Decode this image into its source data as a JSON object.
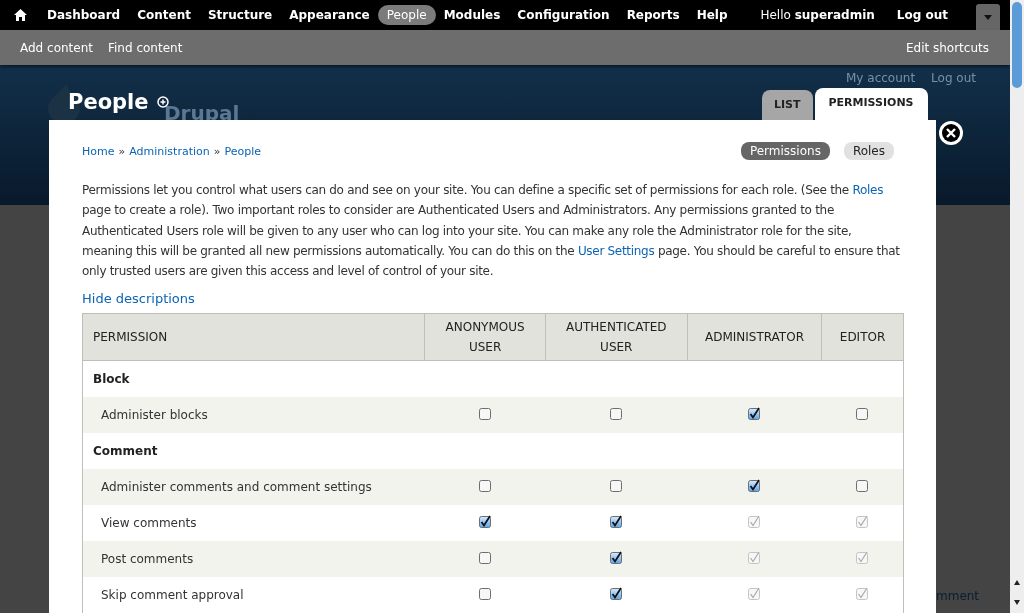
{
  "toolbar": {
    "items": [
      {
        "label": "Dashboard",
        "selected": false
      },
      {
        "label": "Content",
        "selected": false
      },
      {
        "label": "Structure",
        "selected": false
      },
      {
        "label": "Appearance",
        "selected": false
      },
      {
        "label": "People",
        "selected": true
      },
      {
        "label": "Modules",
        "selected": false
      },
      {
        "label": "Configuration",
        "selected": false
      },
      {
        "label": "Reports",
        "selected": false
      },
      {
        "label": "Help",
        "selected": false
      }
    ],
    "greeting": "Hello **superadmin**",
    "logout": "Log out"
  },
  "shortcuts": {
    "items": [
      "Add content",
      "Find content"
    ],
    "edit": "Edit shortcuts"
  },
  "header": {
    "site_name": "Drupal",
    "user_links": [
      "My account",
      "Log out"
    ],
    "page_title": "People",
    "tabs": [
      {
        "label": "LIST",
        "selected": false
      },
      {
        "label": "PERMISSIONS",
        "selected": true
      }
    ]
  },
  "background_link": "mment",
  "overlay": {
    "breadcrumb": [
      "Home",
      "Administration",
      "People"
    ],
    "separator": "»",
    "secondary_tabs": [
      {
        "label": "Permissions",
        "selected": true
      },
      {
        "label": "Roles",
        "selected": false
      }
    ],
    "description": [
      "Permissions let you control what users can do and see on your site. You can define a specific set of permissions for each role. (See the ",
      {
        "link": "Roles"
      },
      " page to create a role). Two important roles to consider are Authenticated Users and Administrators. Any permissions granted to the Authenticated Users role will be given to any user who can log into your site. You can make any role the Administrator role for the site, meaning this will be granted all new permissions automatically. You can do this on the ",
      {
        "link": "User Settings"
      },
      " page. You should be careful to ensure that only trusted users are given this access and level of control of your site."
    ],
    "hide_descriptions": "Hide descriptions",
    "table": {
      "columns": [
        "PERMISSION",
        "ANONYMOUS USER",
        "AUTHENTICATED USER",
        "ADMINISTRATOR",
        "EDITOR"
      ],
      "rows": [
        {
          "kind": "section",
          "label": "Block"
        },
        {
          "kind": "permission",
          "label": "Administer blocks",
          "cells": [
            {
              "checked": false,
              "disabled": false
            },
            {
              "checked": false,
              "disabled": false
            },
            {
              "checked": true,
              "disabled": false
            },
            {
              "checked": false,
              "disabled": false
            }
          ]
        },
        {
          "kind": "section",
          "label": "Comment"
        },
        {
          "kind": "permission",
          "label": "Administer comments and comment settings",
          "cells": [
            {
              "checked": false,
              "disabled": false
            },
            {
              "checked": false,
              "disabled": false
            },
            {
              "checked": true,
              "disabled": false
            },
            {
              "checked": false,
              "disabled": false
            }
          ]
        },
        {
          "kind": "permission",
          "label": "View comments",
          "cells": [
            {
              "checked": true,
              "disabled": false
            },
            {
              "checked": true,
              "disabled": false
            },
            {
              "checked": true,
              "disabled": true
            },
            {
              "checked": true,
              "disabled": true
            }
          ]
        },
        {
          "kind": "permission",
          "label": "Post comments",
          "cells": [
            {
              "checked": false,
              "disabled": false
            },
            {
              "checked": true,
              "disabled": false
            },
            {
              "checked": true,
              "disabled": true
            },
            {
              "checked": true,
              "disabled": true
            }
          ]
        },
        {
          "kind": "permission",
          "label": "Skip comment approval",
          "cells": [
            {
              "checked": false,
              "disabled": false
            },
            {
              "checked": true,
              "disabled": false
            },
            {
              "checked": true,
              "disabled": true
            },
            {
              "checked": true,
              "disabled": true
            }
          ]
        }
      ]
    }
  }
}
